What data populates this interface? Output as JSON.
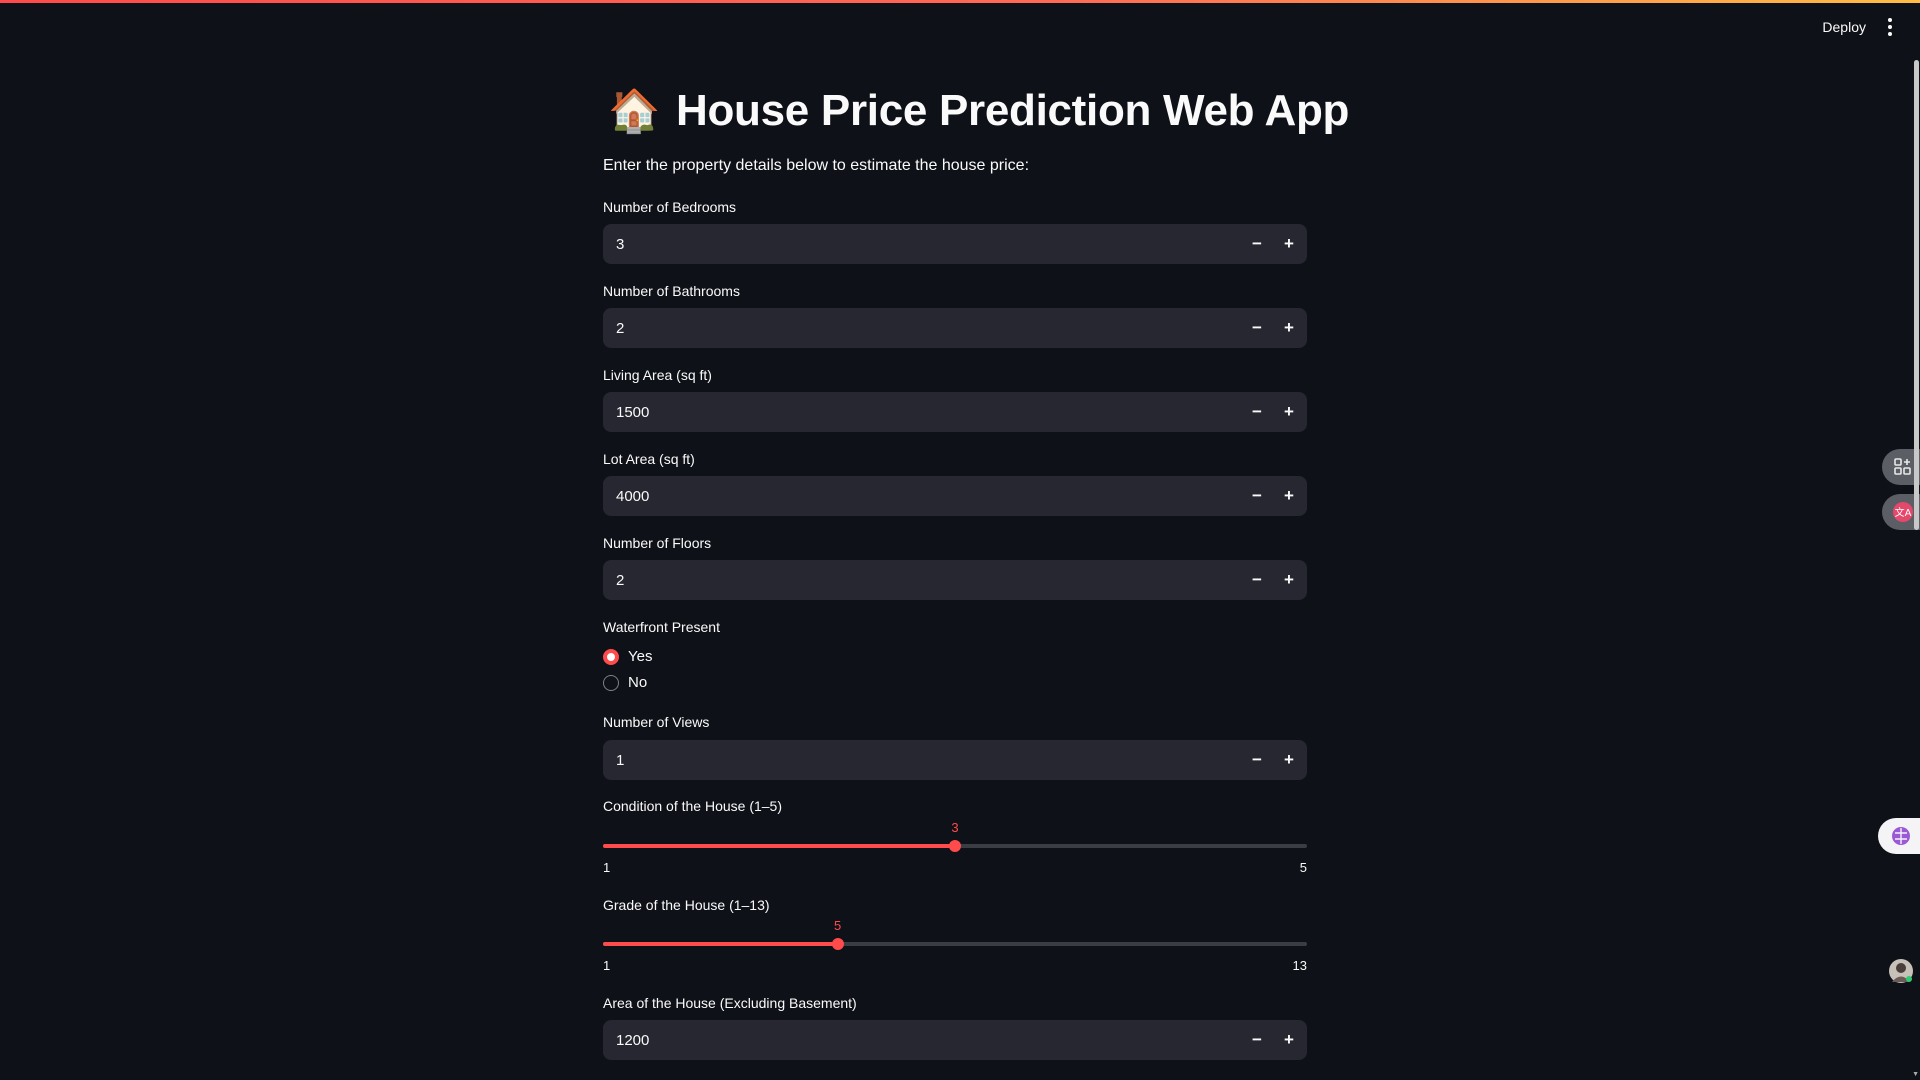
{
  "header": {
    "deploy_label": "Deploy",
    "menu_icon": "kebab-vertical-icon"
  },
  "page": {
    "title_icon": "🏠",
    "title": "House Price Prediction Web App",
    "subtitle": "Enter the property details below to estimate the house price:"
  },
  "fields": {
    "bedrooms": {
      "label": "Number of Bedrooms",
      "value": "3"
    },
    "bathrooms": {
      "label": "Number of Bathrooms",
      "value": "2"
    },
    "living_area": {
      "label": "Living Area (sq ft)",
      "value": "1500"
    },
    "lot_area": {
      "label": "Lot Area (sq ft)",
      "value": "4000"
    },
    "floors": {
      "label": "Number of Floors",
      "value": "2"
    },
    "views": {
      "label": "Number of Views",
      "value": "1"
    },
    "area_excl_basement": {
      "label": "Area of the House (Excluding Basement)",
      "value": "1200"
    }
  },
  "stepper": {
    "minus": "−",
    "plus": "+"
  },
  "waterfront": {
    "label": "Waterfront Present",
    "options": [
      "Yes",
      "No"
    ],
    "selected": "Yes"
  },
  "sliders": {
    "condition": {
      "label": "Condition of the House (1–5)",
      "min": "1",
      "max": "5",
      "value": "3"
    },
    "grade": {
      "label": "Grade of the House (1–13)",
      "min": "1",
      "max": "13",
      "value": "5"
    }
  },
  "colors": {
    "accent": "#ff4b4b",
    "background": "#0e1117",
    "input_bg": "#262730"
  }
}
